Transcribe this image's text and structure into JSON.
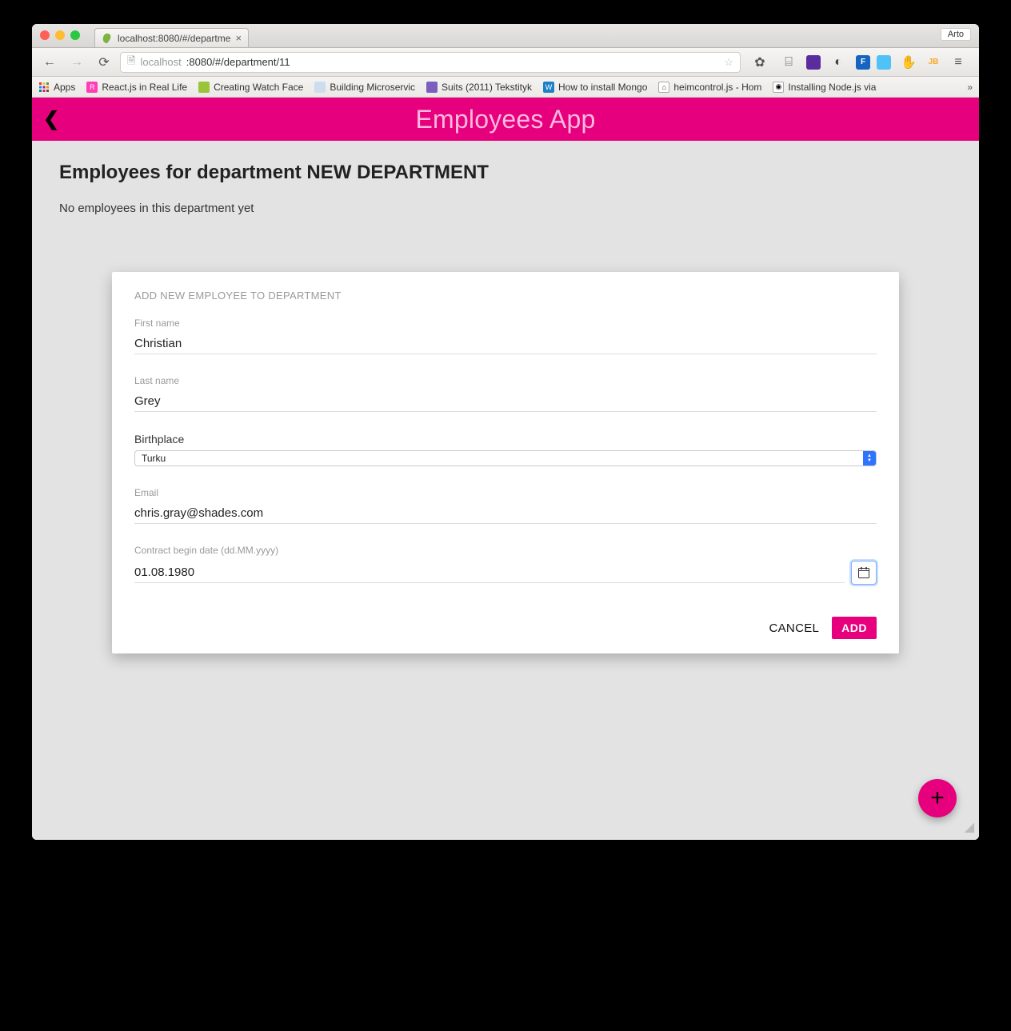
{
  "browser": {
    "user_badge": "Arto",
    "tab_title": "localhost:8080/#/departme",
    "url_host_faded": "localhost",
    "url_rest": ":8080/#/department/11"
  },
  "bookmarks": [
    {
      "label": "Apps",
      "color": "grid"
    },
    {
      "label": "React.js in Real Life",
      "color": "#ff3db6"
    },
    {
      "label": "Creating Watch Face",
      "color": "#9ac53b"
    },
    {
      "label": "Building Microservic",
      "color": "#4aa"
    },
    {
      "label": "Suits (2011) Tekstityk",
      "color": "#7a5fbf"
    },
    {
      "label": "How to install Mongo",
      "color": "#1e80c7"
    },
    {
      "label": "heimcontrol.js - Hom",
      "color": "#333"
    },
    {
      "label": "Installing Node.js via",
      "color": "#000"
    }
  ],
  "app": {
    "title": "Employees App",
    "heading": "Employees for department NEW DEPARTMENT",
    "empty_text": "No employees in this department yet"
  },
  "modal": {
    "title": "ADD NEW EMPLOYEE TO DEPARTMENT",
    "first_name_label": "First name",
    "first_name_value": "Christian",
    "last_name_label": "Last name",
    "last_name_value": "Grey",
    "birthplace_label": "Birthplace",
    "birthplace_value": "Turku",
    "email_label": "Email",
    "email_value": "chris.gray@shades.com",
    "contract_label": "Contract begin date (dd.MM.yyyy)",
    "contract_value": "01.08.1980",
    "cancel_label": "CANCEL",
    "add_label": "ADD"
  },
  "colors": {
    "accent": "#e6007e"
  }
}
